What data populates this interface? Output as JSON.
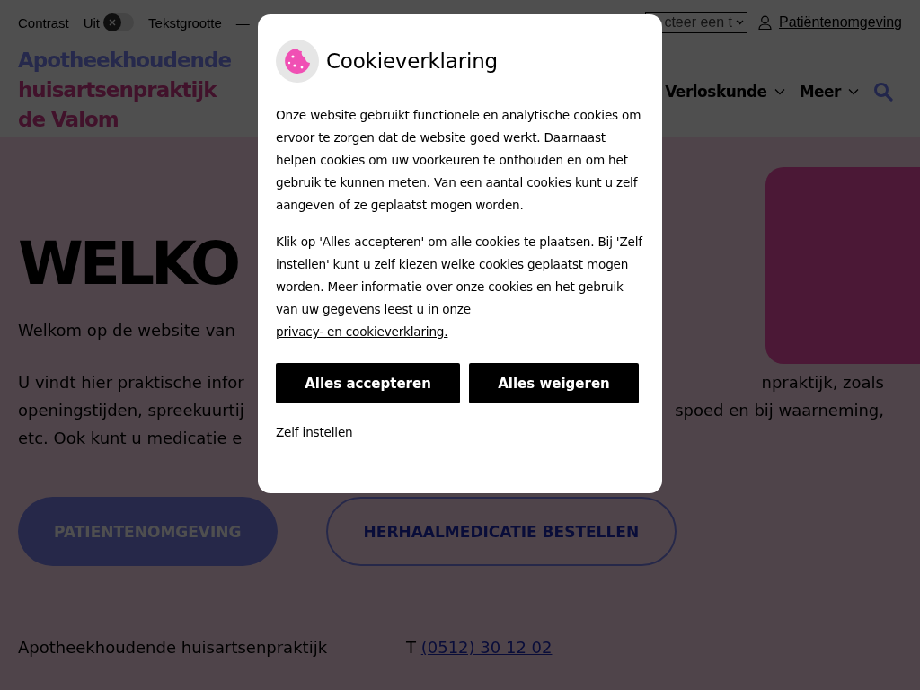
{
  "top_bar": {
    "contrast_label": "Contrast",
    "contrast_state": "Uit",
    "contrast_on": false,
    "text_size_label": "Tekstgrootte",
    "text_size_control": "—",
    "language_select": "cteer een t",
    "patient_link": "Patiëntenomgeving"
  },
  "logo": [
    "Apotheekhoudende",
    "huisartsenpraktijk",
    "de Valom"
  ],
  "nav": [
    {
      "label": "Verloskunde"
    },
    {
      "label": "Meer"
    }
  ],
  "hero": {
    "heading": "WELKO",
    "intro": "Welkom op de website van",
    "lines": [
      {
        "left": "U vindt hier praktische infor",
        "right": "npraktijk, zoals"
      },
      {
        "left": "openingstijden, spreekuurtij",
        "right": "spoed en bij waarneming,"
      },
      {
        "left": "etc. Ook kunt u medicatie e"
      }
    ]
  },
  "buttons": [
    {
      "label": "PATIENTENOMGEVING",
      "kind": "filled"
    },
    {
      "label": "HERHAALMEDICATIE BESTELLEN",
      "kind": "outline"
    }
  ],
  "contact": {
    "name": "Apotheekhoudende huisartsenpraktijk",
    "phone_label": "T",
    "phone": "(0512) 30 12 02"
  },
  "cookie_dialog": {
    "title": "Cookieverklaring",
    "paragraph_1": "Onze website gebruikt functionele en analytische cookies om ervoor te zorgen dat de website goed werkt. Daarnaast helpen cookies om uw voorkeuren te onthouden en om het gebruik te kunnen meten. Van een aantal cookies kunt u zelf aangeven of ze geplaatst mogen worden.",
    "paragraph_2": "Klik op 'Alles accepteren' om alle cookies te plaatsen. Bij 'Zelf instellen' kunt u zelf kiezen welke cookies geplaatst mogen worden. Meer informatie over onze cookies en het gebruik van uw gegevens leest u in onze",
    "privacy_link": "privacy- en cookieverklaring.",
    "accept_button": "Alles accepteren",
    "reject_button": "Alles weigeren",
    "settings_link": "Zelf instellen"
  }
}
